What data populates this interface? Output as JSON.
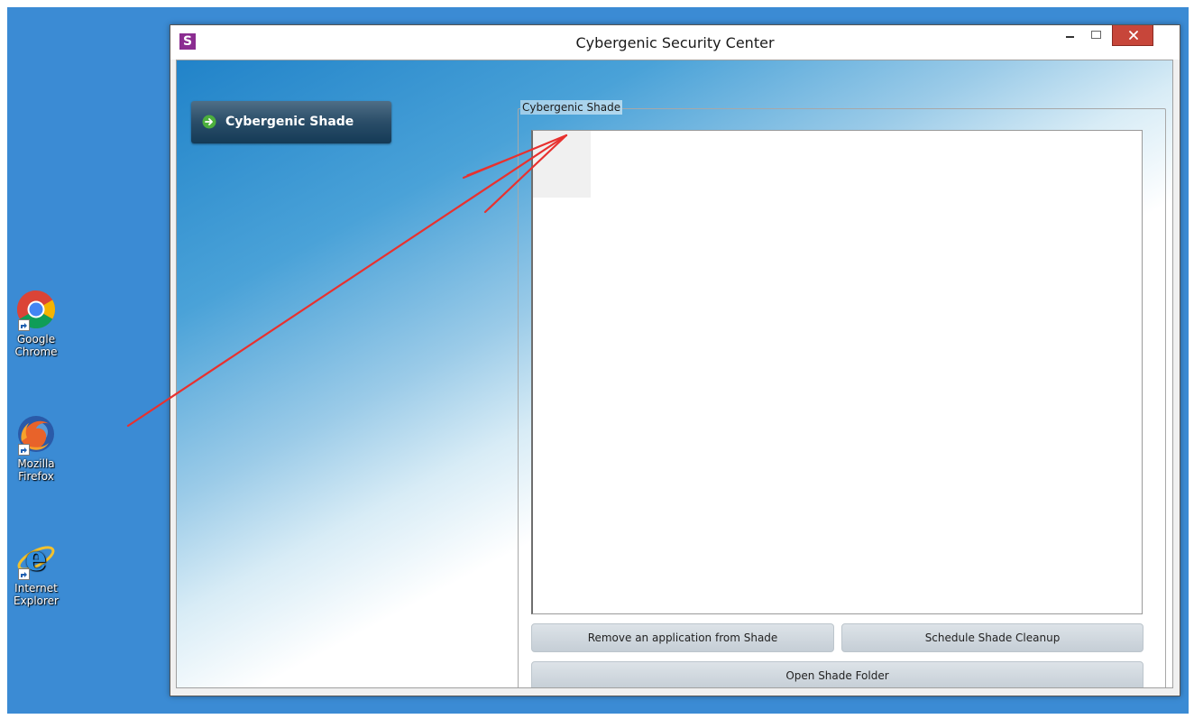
{
  "desktop": {
    "icons": [
      {
        "name": "google-chrome",
        "label_line1": "Google",
        "label_line2": "Chrome"
      },
      {
        "name": "mozilla-firefox",
        "label_line1": "Mozilla",
        "label_line2": "Firefox"
      },
      {
        "name": "internet-explorer",
        "label_line1": "Internet",
        "label_line2": "Explorer"
      }
    ]
  },
  "window": {
    "title": "Cybergenic Security Center",
    "app_icon_letter": "S",
    "controls": {
      "minimize": "minimize-icon",
      "maximize": "maximize-icon",
      "close": "close-icon"
    }
  },
  "sidebar": {
    "active_item": {
      "label": "Cybergenic Shade",
      "icon": "arrow-right-circle-icon"
    }
  },
  "main": {
    "group_title": "Cybergenic Shade",
    "list_items": [],
    "buttons": {
      "remove_app": "Remove an application from Shade",
      "schedule_cleanup": "Schedule Shade Cleanup",
      "open_folder": "Open Shade Folder"
    }
  },
  "annotation": {
    "color": "#e8312f"
  },
  "colors": {
    "desktop": "#3b8bd4",
    "app_icon": "#8b2d91",
    "close_button": "#c7463a",
    "nav_button": "#2a4d68",
    "nav_arrow": "#4caf3d"
  }
}
